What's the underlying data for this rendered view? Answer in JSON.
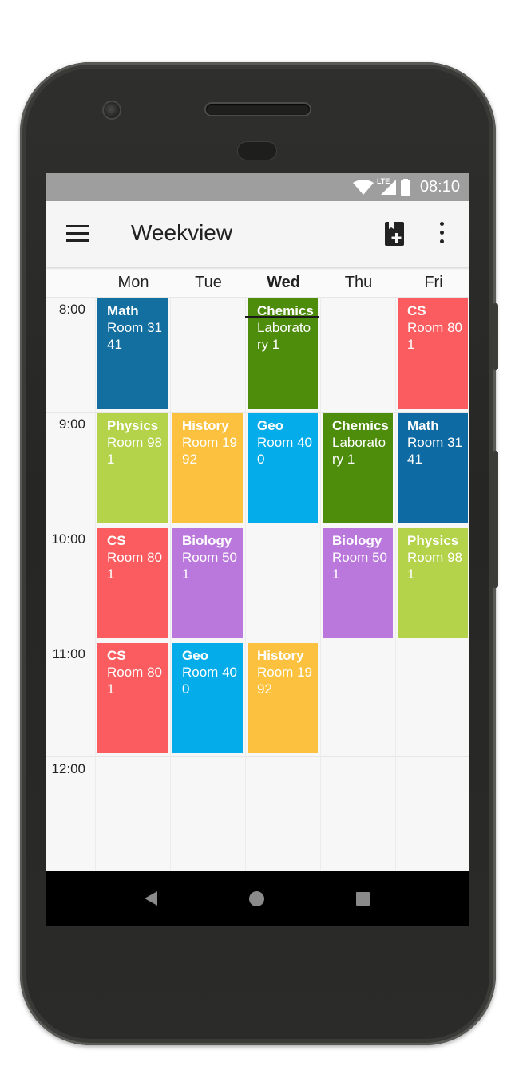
{
  "status_bar": {
    "time": "08:10",
    "network_label": "LTE"
  },
  "app_bar": {
    "title": "Weekview"
  },
  "days": [
    "Mon",
    "Tue",
    "Wed",
    "Thu",
    "Fri"
  ],
  "today": "Wed",
  "times": [
    "8:00",
    "9:00",
    "10:00",
    "11:00",
    "12:00"
  ],
  "lessons": [
    {
      "day": 0,
      "slot": 0,
      "subject": "Math",
      "room": "Room 3141",
      "color": "#126fa0"
    },
    {
      "day": 2,
      "slot": 0,
      "subject": "Chemics",
      "room": "Laboratory 1",
      "color": "#4e8c0c"
    },
    {
      "day": 4,
      "slot": 0,
      "subject": "CS",
      "room": "Room 801",
      "color": "#fa5c5f"
    },
    {
      "day": 0,
      "slot": 1,
      "subject": "Physics",
      "room": "Room 981",
      "color": "#b4d24a"
    },
    {
      "day": 1,
      "slot": 1,
      "subject": "History",
      "room": "Room 1992",
      "color": "#fcc23f"
    },
    {
      "day": 2,
      "slot": 1,
      "subject": "Geo",
      "room": "Room 400",
      "color": "#04adea"
    },
    {
      "day": 3,
      "slot": 1,
      "subject": "Chemics",
      "room": "Laboratory 1",
      "color": "#4e8c0c"
    },
    {
      "day": 4,
      "slot": 1,
      "subject": "Math",
      "room": "Room 3141",
      "color": "#0e6aa3"
    },
    {
      "day": 0,
      "slot": 2,
      "subject": "CS",
      "room": "Room 801",
      "color": "#fa5c5f"
    },
    {
      "day": 1,
      "slot": 2,
      "subject": "Biology",
      "room": "Room 501",
      "color": "#ba78dc"
    },
    {
      "day": 3,
      "slot": 2,
      "subject": "Biology",
      "room": "Room 501",
      "color": "#ba78dc"
    },
    {
      "day": 4,
      "slot": 2,
      "subject": "Physics",
      "room": "Room 981",
      "color": "#b4d24a"
    },
    {
      "day": 0,
      "slot": 3,
      "subject": "CS",
      "room": "Room 801",
      "color": "#fa5c5f"
    },
    {
      "day": 1,
      "slot": 3,
      "subject": "Geo",
      "room": "Room 400",
      "color": "#04adea"
    },
    {
      "day": 2,
      "slot": 3,
      "subject": "History",
      "room": "Room 1992",
      "color": "#fcc23f"
    }
  ],
  "icons": {
    "menu": "menu-icon",
    "add": "add-lesson-icon",
    "more": "more-vert-icon",
    "back": "nav-back-icon",
    "home": "nav-home-icon",
    "recent": "nav-recent-icon"
  }
}
